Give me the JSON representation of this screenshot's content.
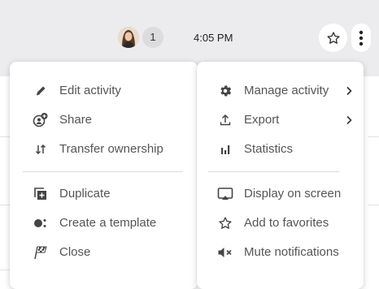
{
  "header": {
    "participant_count": "1",
    "time": "4:05 PM"
  },
  "icons": {
    "favorite": "star-outline-icon",
    "more": "kebab-menu-icon"
  },
  "menu_left": {
    "items": [
      {
        "label": "Edit activity",
        "icon": "pencil-icon"
      },
      {
        "label": "Share",
        "icon": "share-person-plus-icon"
      },
      {
        "label": "Transfer ownership",
        "icon": "transfer-arrows-icon"
      },
      {
        "label": "Duplicate",
        "icon": "duplicate-icon"
      },
      {
        "label": "Create a template",
        "icon": "template-icon"
      },
      {
        "label": "Close",
        "icon": "finish-flag-icon"
      }
    ]
  },
  "menu_right": {
    "items": [
      {
        "label": "Manage activity",
        "icon": "gear-icon",
        "submenu": true
      },
      {
        "label": "Export",
        "icon": "upload-icon",
        "submenu": true
      },
      {
        "label": "Statistics",
        "icon": "bar-chart-icon"
      },
      {
        "label": "Display on screen",
        "icon": "cast-screen-icon"
      },
      {
        "label": "Add to favorites",
        "icon": "star-outline-icon"
      },
      {
        "label": "Mute notifications",
        "icon": "mute-icon"
      }
    ]
  },
  "colors": {
    "topbar": "#ececee",
    "menu_text": "#555555",
    "icon": "#444444"
  }
}
